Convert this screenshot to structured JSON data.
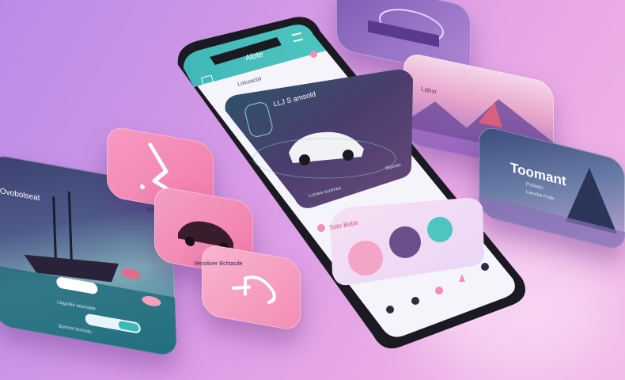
{
  "phone": {
    "header_title": "Aſote",
    "search_label": "Lnicsacbii",
    "hero_title": "LLJ S amsold",
    "hero_sub": "Sisonto",
    "hero_bottom": "Lrzoes sucimes",
    "section_title": "Ssto Bobit",
    "bottom_nav": [
      "",
      "",
      "",
      "",
      ""
    ]
  },
  "cards": {
    "left_title": "Ovobolseat",
    "left_line1": "Lisgroke sesmoke",
    "left_line2": "Ssnrsot tnrrcotu",
    "pink_top_caption": "Itolesaom Lisn",
    "pink_bottom_caption": "Vensitiver Bchtacde",
    "right_top_caption": "",
    "right_mid_caption": "Lahsr",
    "right_bottom_title": "Toomant",
    "right_bottom_sub": "Pobiaito",
    "right_bottom_line": "Lwocka Fsde"
  },
  "colors": {
    "bg_start": "#b98be8",
    "bg_end": "#f3b9e7",
    "teal": "#3fb8b8",
    "pink": "#f78db6",
    "dark": "#1d1b2a"
  }
}
